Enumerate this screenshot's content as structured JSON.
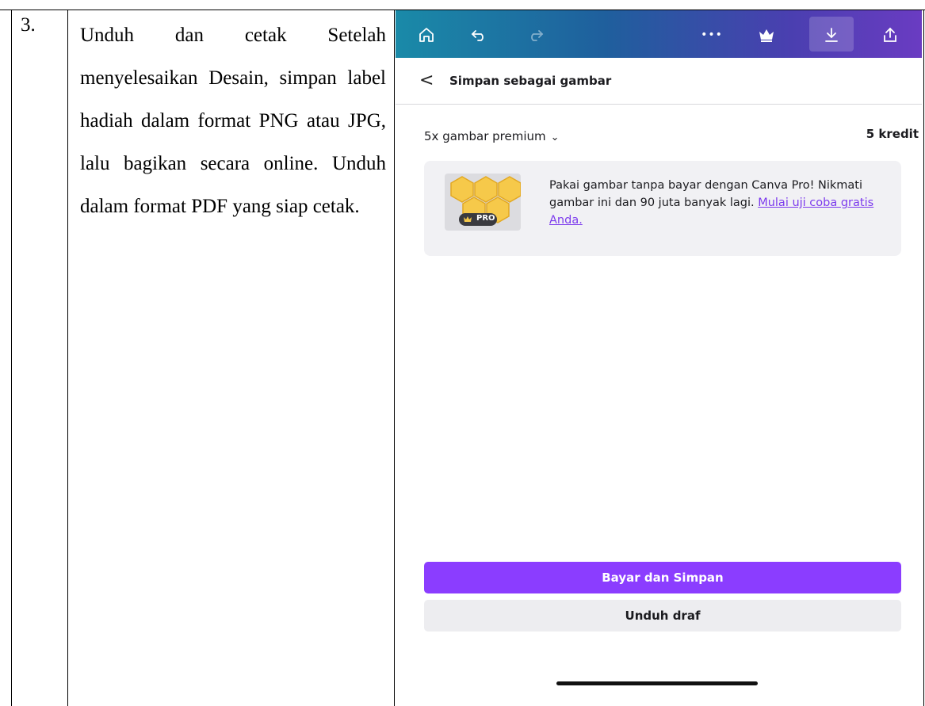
{
  "row": {
    "number": "3.",
    "description": "Unduh dan cetak Setelah menyelesaikan Desain, simpan label hadiah dalam format PNG atau JPG, lalu bagikan secara online. Unduh dalam format PDF yang siap cetak."
  },
  "toolbar": {
    "icons": [
      "home-icon",
      "undo-icon",
      "redo-icon",
      "more-icon",
      "crown-icon",
      "download-icon",
      "share-icon"
    ],
    "more_label": "•••"
  },
  "header": {
    "back_glyph": "<",
    "title": "Simpan sebagai gambar"
  },
  "selection": {
    "label": "5x gambar premium",
    "chevron": "⌄",
    "credits": "5 kredit"
  },
  "promo": {
    "badge": "PRO",
    "text": "Pakai gambar tanpa bayar dengan Canva Pro! Nikmati gambar ini dan 90 juta banyak lagi.",
    "link": "Mulai uji coba gratis Anda."
  },
  "actions": {
    "primary": "Bayar dan Simpan",
    "secondary": "Unduh draf"
  },
  "colors": {
    "accent": "#8b3dff",
    "link": "#7c3aed",
    "honey": "#f6c94a"
  }
}
